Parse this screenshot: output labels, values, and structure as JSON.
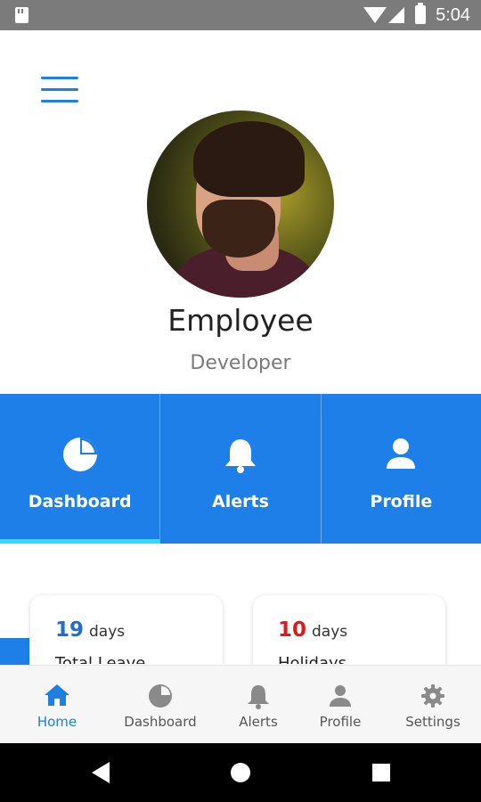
{
  "status_bar": {
    "time": "5:04"
  },
  "profile": {
    "name": "Employee",
    "role": "Developer"
  },
  "tiles": [
    {
      "label": "Dashboard",
      "icon": "pie-chart-icon",
      "active": true
    },
    {
      "label": "Alerts",
      "icon": "bell-icon",
      "active": false
    },
    {
      "label": "Profile",
      "icon": "person-icon",
      "active": false
    }
  ],
  "cards": [
    {
      "number": "19",
      "unit": "days",
      "label": "Total Leave",
      "number_color": "#1e6fd0"
    },
    {
      "number": "10",
      "unit": "days",
      "label": "Holidays",
      "number_color": "#e01a1a"
    }
  ],
  "bottom_nav": [
    {
      "label": "Home",
      "icon": "home-icon",
      "active": true
    },
    {
      "label": "Dashboard",
      "icon": "pie-chart-icon",
      "active": false
    },
    {
      "label": "Alerts",
      "icon": "bell-icon",
      "active": false
    },
    {
      "label": "Profile",
      "icon": "person-icon",
      "active": false
    },
    {
      "label": "Settings",
      "icon": "gear-icon",
      "active": false
    }
  ],
  "colors": {
    "accent": "#1e7fe8",
    "tab_indicator": "#2ee0f6",
    "status_bar": "#7b7b7b"
  }
}
